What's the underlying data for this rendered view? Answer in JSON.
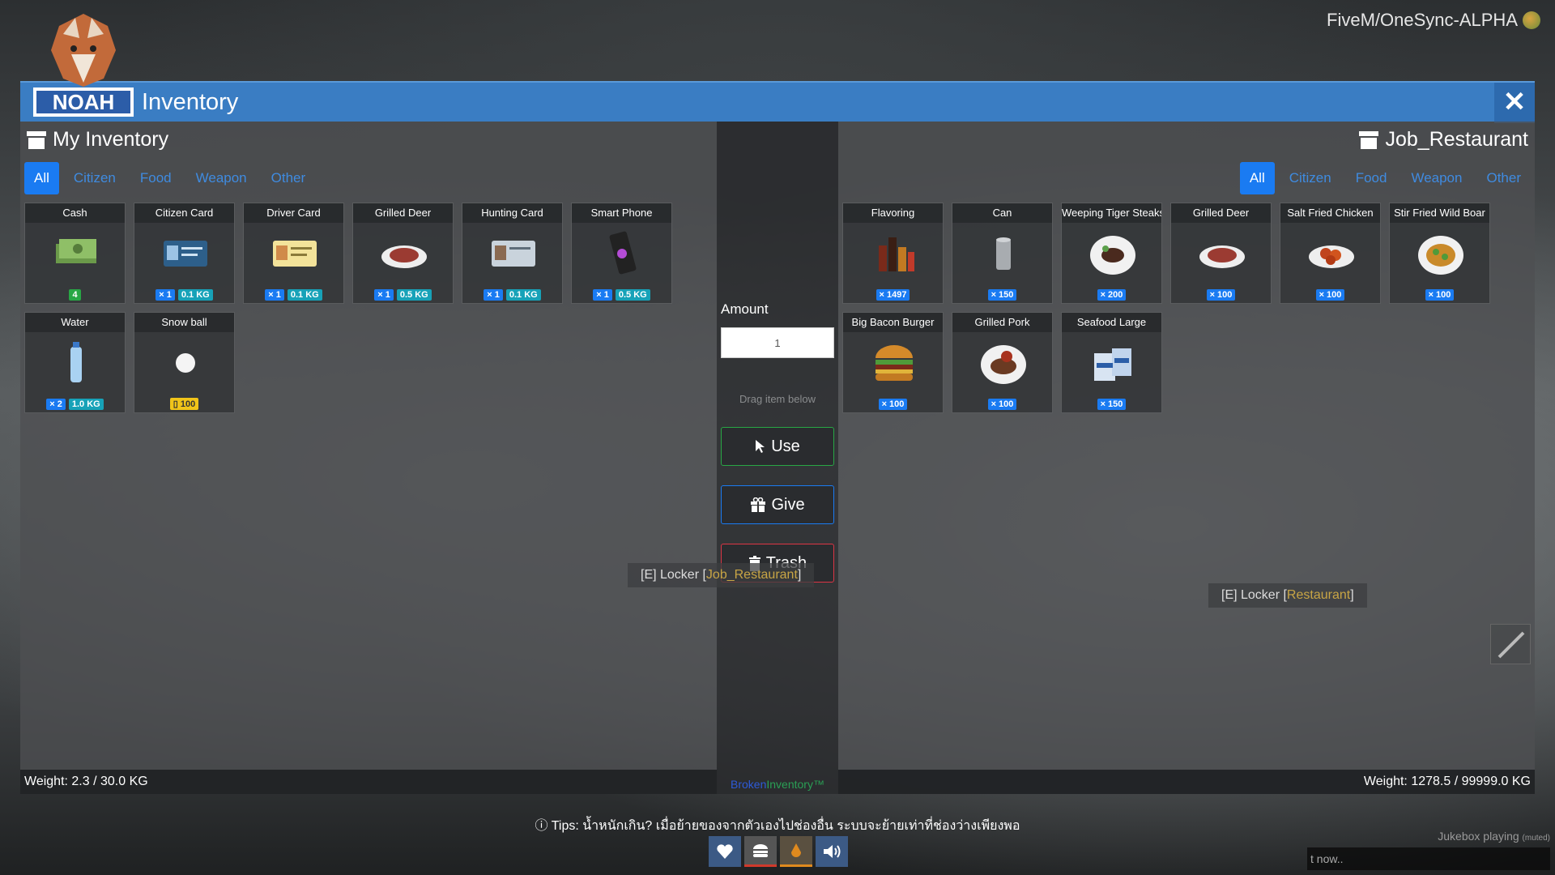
{
  "server": {
    "title": "FiveM/OneSync-ALPHA"
  },
  "window": {
    "title": "Inventory",
    "close_label": "✕"
  },
  "logo": {
    "text": "NOAH"
  },
  "left": {
    "title": "My Inventory",
    "tabs": [
      {
        "label": "All",
        "active": true
      },
      {
        "label": "Citizen",
        "active": false
      },
      {
        "label": "Food",
        "active": false
      },
      {
        "label": "Weapon",
        "active": false
      },
      {
        "label": "Other",
        "active": false
      }
    ],
    "items": [
      {
        "name": "Cash",
        "icon": "cash-icon",
        "badges": [
          {
            "text": "4",
            "color": "green"
          }
        ]
      },
      {
        "name": "Citizen Card",
        "icon": "id-card-icon",
        "badges": [
          {
            "text": "× 1",
            "color": "blue"
          },
          {
            "text": "0.1 KG",
            "color": "cyan"
          }
        ]
      },
      {
        "name": "Driver Card",
        "icon": "driver-card-icon",
        "badges": [
          {
            "text": "× 1",
            "color": "blue"
          },
          {
            "text": "0.1 KG",
            "color": "cyan"
          }
        ]
      },
      {
        "name": "Grilled Deer",
        "icon": "grilled-meat-icon",
        "badges": [
          {
            "text": "× 1",
            "color": "blue"
          },
          {
            "text": "0.5 KG",
            "color": "cyan"
          }
        ]
      },
      {
        "name": "Hunting Card",
        "icon": "hunting-card-icon",
        "badges": [
          {
            "text": "× 1",
            "color": "blue"
          },
          {
            "text": "0.1 KG",
            "color": "cyan"
          }
        ]
      },
      {
        "name": "Smart Phone",
        "icon": "phone-icon",
        "badges": [
          {
            "text": "× 1",
            "color": "blue"
          },
          {
            "text": "0.5 KG",
            "color": "cyan"
          }
        ]
      },
      {
        "name": "Water",
        "icon": "water-bottle-icon",
        "badges": [
          {
            "text": "× 2",
            "color": "blue"
          },
          {
            "text": "1.0 KG",
            "color": "cyan"
          }
        ]
      },
      {
        "name": "Snow ball",
        "icon": "snowball-icon",
        "badges": [
          {
            "text": "▯ 100",
            "color": "yellow"
          }
        ]
      }
    ],
    "weight": "Weight: 2.3 / 30.0 KG"
  },
  "right": {
    "title": "Job_Restaurant",
    "tabs": [
      {
        "label": "All",
        "active": true
      },
      {
        "label": "Citizen",
        "active": false
      },
      {
        "label": "Food",
        "active": false
      },
      {
        "label": "Weapon",
        "active": false
      },
      {
        "label": "Other",
        "active": false
      }
    ],
    "items": [
      {
        "name": "Flavoring",
        "icon": "sauce-bottles-icon",
        "badges": [
          {
            "text": "× 1497",
            "color": "blue"
          }
        ]
      },
      {
        "name": "Can",
        "icon": "can-icon",
        "badges": [
          {
            "text": "× 150",
            "color": "blue"
          }
        ]
      },
      {
        "name": "Weeping Tiger Steaks",
        "icon": "steak-plate-icon",
        "badges": [
          {
            "text": "× 200",
            "color": "blue"
          }
        ]
      },
      {
        "name": "Grilled Deer",
        "icon": "grilled-meat-icon",
        "badges": [
          {
            "text": "× 100",
            "color": "blue"
          }
        ]
      },
      {
        "name": "Salt Fried Chicken",
        "icon": "fried-chicken-icon",
        "badges": [
          {
            "text": "× 100",
            "color": "blue"
          }
        ]
      },
      {
        "name": "Stir Fried Wild Boar",
        "icon": "stir-fry-icon",
        "badges": [
          {
            "text": "× 100",
            "color": "blue"
          }
        ]
      },
      {
        "name": "Big Bacon Burger",
        "icon": "burger-icon",
        "badges": [
          {
            "text": "× 100",
            "color": "blue"
          }
        ]
      },
      {
        "name": "Grilled Pork",
        "icon": "grilled-pork-icon",
        "badges": [
          {
            "text": "× 100",
            "color": "blue"
          }
        ]
      },
      {
        "name": "Seafood Large",
        "icon": "seafood-pack-icon",
        "badges": [
          {
            "text": "× 150",
            "color": "blue"
          }
        ]
      }
    ],
    "weight": "Weight: 1278.5 / 99999.0 KG"
  },
  "middle": {
    "amount_label": "Amount",
    "amount_value": "1",
    "drag_hint": "Drag item below",
    "use_label": "Use",
    "give_label": "Give",
    "trash_label": "Trash",
    "brand_a": "Broken",
    "brand_b": "Inventory™"
  },
  "world": {
    "locker1_prefix": "[E] Locker [",
    "locker1_tag": "Job_Restaurant",
    "locker1_suffix": "]",
    "locker2_prefix": "[E] Locker [",
    "locker2_tag": "Restaurant",
    "locker2_suffix": "]"
  },
  "hud": {
    "tips": "Tips: น้ำหนักเกิน? เมื่อย้ายของจากตัวเองไปช่องอื่น ระบบจะย้ายเท่าที่ช่องว่างเพียงพอ",
    "jukebox": "Jukebox playing",
    "jukebox_status": "(muted)",
    "chat_placeholder": "t now.."
  },
  "colors": {
    "accent": "#1a7bf2",
    "titlebar": "#3a7dc3",
    "use": "#28a745",
    "give": "#1a7bf2",
    "trash": "#dc3545"
  }
}
